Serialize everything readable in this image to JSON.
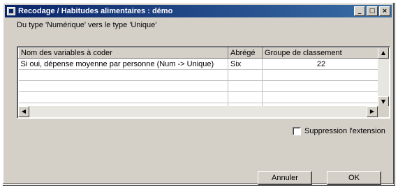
{
  "window": {
    "title": "Recodage / Habitudes alimentaires : démo"
  },
  "description": "Du type 'Numérique' vers le type 'Unique'",
  "grid": {
    "headers": [
      "Nom des variables à coder",
      "Abrégé",
      "Groupe de classement"
    ],
    "rows": [
      [
        "Si oui, dépense moyenne par personne (Num -> Unique)",
        "Six",
        "22"
      ]
    ]
  },
  "checkbox": {
    "label": "Suppression l'extension",
    "checked": false
  },
  "buttons": {
    "cancel": "Annuler",
    "ok": "OK"
  }
}
